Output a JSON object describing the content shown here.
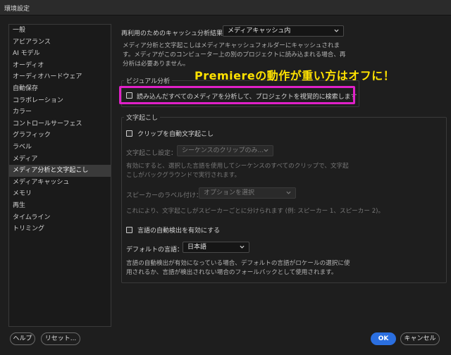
{
  "window": {
    "title": "環境設定"
  },
  "sidebar": {
    "items": [
      {
        "label": "一般"
      },
      {
        "label": "アピアランス"
      },
      {
        "label": "AI モデル"
      },
      {
        "label": "オーディオ"
      },
      {
        "label": "オーディオハードウェア"
      },
      {
        "label": "自動保存"
      },
      {
        "label": "コラボレーション"
      },
      {
        "label": "カラー"
      },
      {
        "label": "コントロールサーフェス"
      },
      {
        "label": "グラフィック"
      },
      {
        "label": "ラベル"
      },
      {
        "label": "メディア"
      },
      {
        "label": "メディア分析と文字起こし",
        "selected": true
      },
      {
        "label": "メディアキャッシュ"
      },
      {
        "label": "メモリ"
      },
      {
        "label": "再生"
      },
      {
        "label": "タイムライン"
      },
      {
        "label": "トリミング"
      }
    ]
  },
  "cache": {
    "label": "再利用のためのキャッシュ分析結果：",
    "value": "メディアキャッシュ内",
    "desc_1": "メディア分析と文字起こしはメディアキャッシュフォルダーにキャッシュされま",
    "desc_2": "す。メディアがこのコンピューター上の別のプロジェクトに読み込まれる場合、再",
    "desc_3": "分析は必要ありません。"
  },
  "visual": {
    "title": "ビジュアル分析",
    "checkbox_label": "読み込んだすべてのメディアを分析して、プロジェクトを視覚的に検索します"
  },
  "annotation": {
    "text": "Premiereの動作が重い方はオフに！"
  },
  "transcription": {
    "title": "文字起こし",
    "auto_label": "クリップを自動文字起こし",
    "settings_label": "文字起こし設定：",
    "settings_value": "シーケンスのクリップのみ...",
    "desc_1a": "有効にすると、選択した言語を使用してシーケンスのすべてのクリップで、文字起",
    "desc_1b": "こしがバックグラウンドで実行されます。",
    "speaker_label": "スピーカーのラベル付け：",
    "speaker_value": "オプションを選択",
    "desc_2": "これにより、文字起こしがスピーカーごとに分けられます (例: スピーカー 1、スピーカー 2)。",
    "lang_detect_label": "言語の自動検出を有効にする",
    "default_lang_label": "デフォルトの言語：",
    "default_lang_value": "日本語",
    "desc_3a": "言語の自動検出が有効になっている場合、デフォルトの言語がロケールの選択に使",
    "desc_3b": "用されるか、言語が検出されない場合のフォールバックとして使用されます。"
  },
  "footer": {
    "help": "ヘルプ",
    "reset": "リセット...",
    "ok": "OK",
    "cancel": "キャンセル"
  }
}
